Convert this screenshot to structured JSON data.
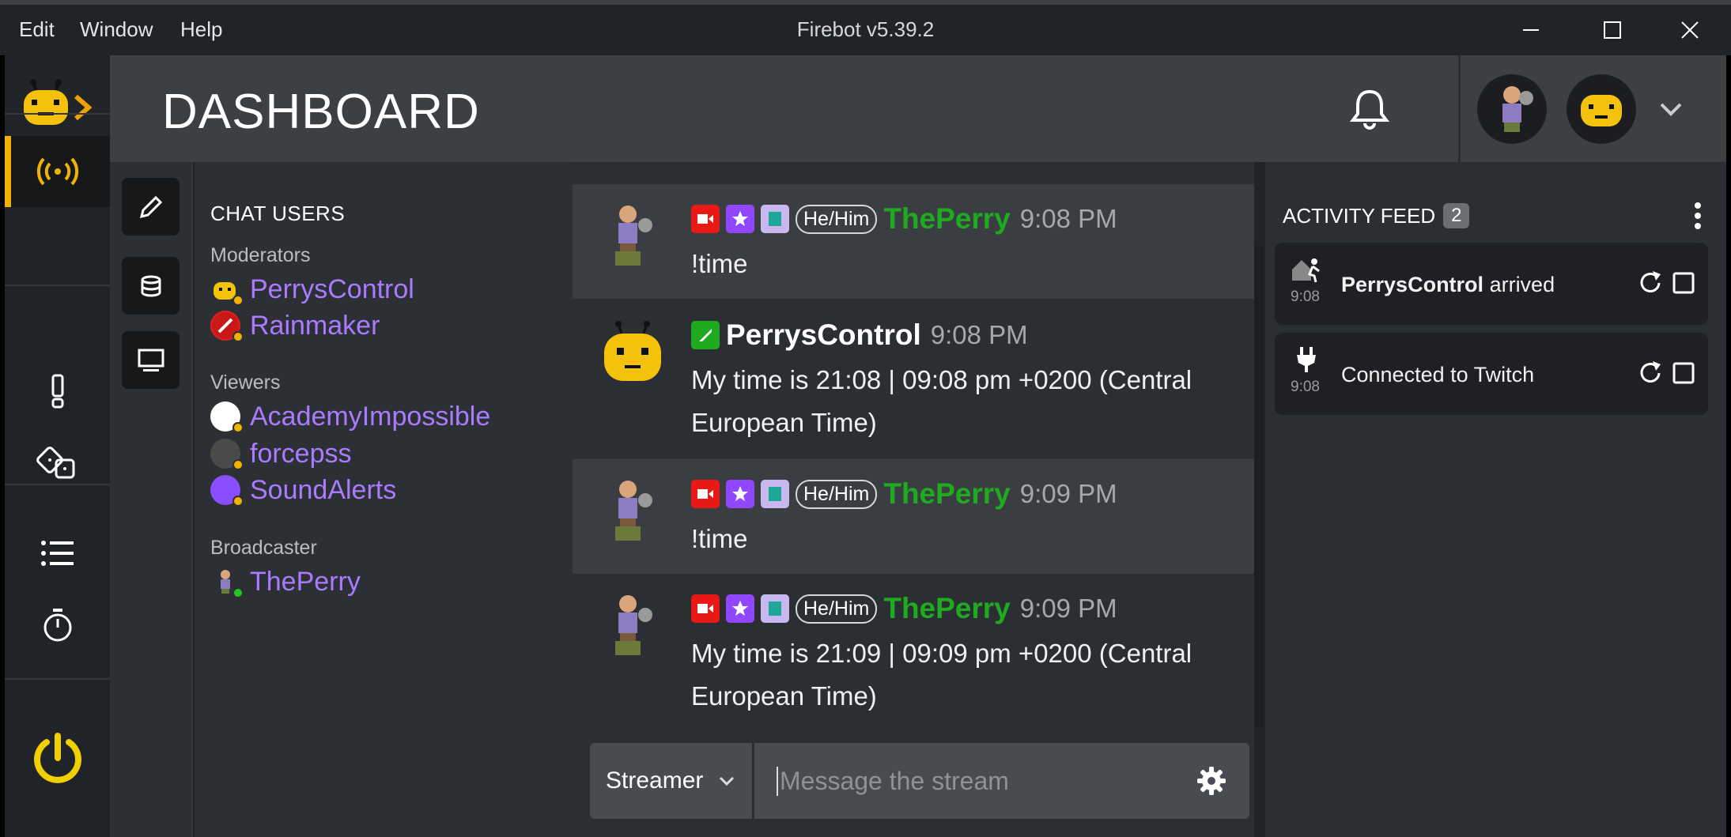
{
  "window": {
    "title": "Firebot v5.39.2",
    "menu": [
      "Edit",
      "Window",
      "Help"
    ]
  },
  "header": {
    "page_title": "DASHBOARD"
  },
  "colors": {
    "accent": "#f0b400",
    "username_purple": "#a97cff",
    "username_green": "#1faa1f"
  },
  "users_panel": {
    "title": "CHAT USERS",
    "moderators_label": "Moderators",
    "moderators": [
      "PerrysControl",
      "Rainmaker"
    ],
    "viewers_label": "Viewers",
    "viewers": [
      "AcademyImpossible",
      "forcepss",
      "SoundAlerts"
    ],
    "broadcaster_label": "Broadcaster",
    "broadcaster": [
      "ThePerry"
    ]
  },
  "chat": {
    "messages": [
      {
        "user": "ThePerry",
        "pronoun": "He/Him",
        "time": "9:08 PM",
        "text": "!time"
      },
      {
        "user": "PerrysControl",
        "time": "9:08 PM",
        "text": "My time is 21:08 | 09:08 pm +0200 (Central European Time)"
      },
      {
        "user": "ThePerry",
        "pronoun": "He/Him",
        "time": "9:09 PM",
        "text": "!time"
      },
      {
        "user": "ThePerry",
        "pronoun": "He/Him",
        "time": "9:09 PM",
        "text": "My time is 21:09 | 09:09 pm +0200 (Central European Time)"
      }
    ],
    "input": {
      "role": "Streamer",
      "placeholder": "Message the stream"
    }
  },
  "activity_feed": {
    "title": "ACTIVITY FEED",
    "count": "2",
    "items": [
      {
        "time": "9:08",
        "user": "PerrysControl",
        "text": " arrived",
        "icon": "door-walk-icon"
      },
      {
        "time": "9:08",
        "user": "",
        "text": "Connected to Twitch",
        "icon": "plug-icon"
      }
    ]
  }
}
